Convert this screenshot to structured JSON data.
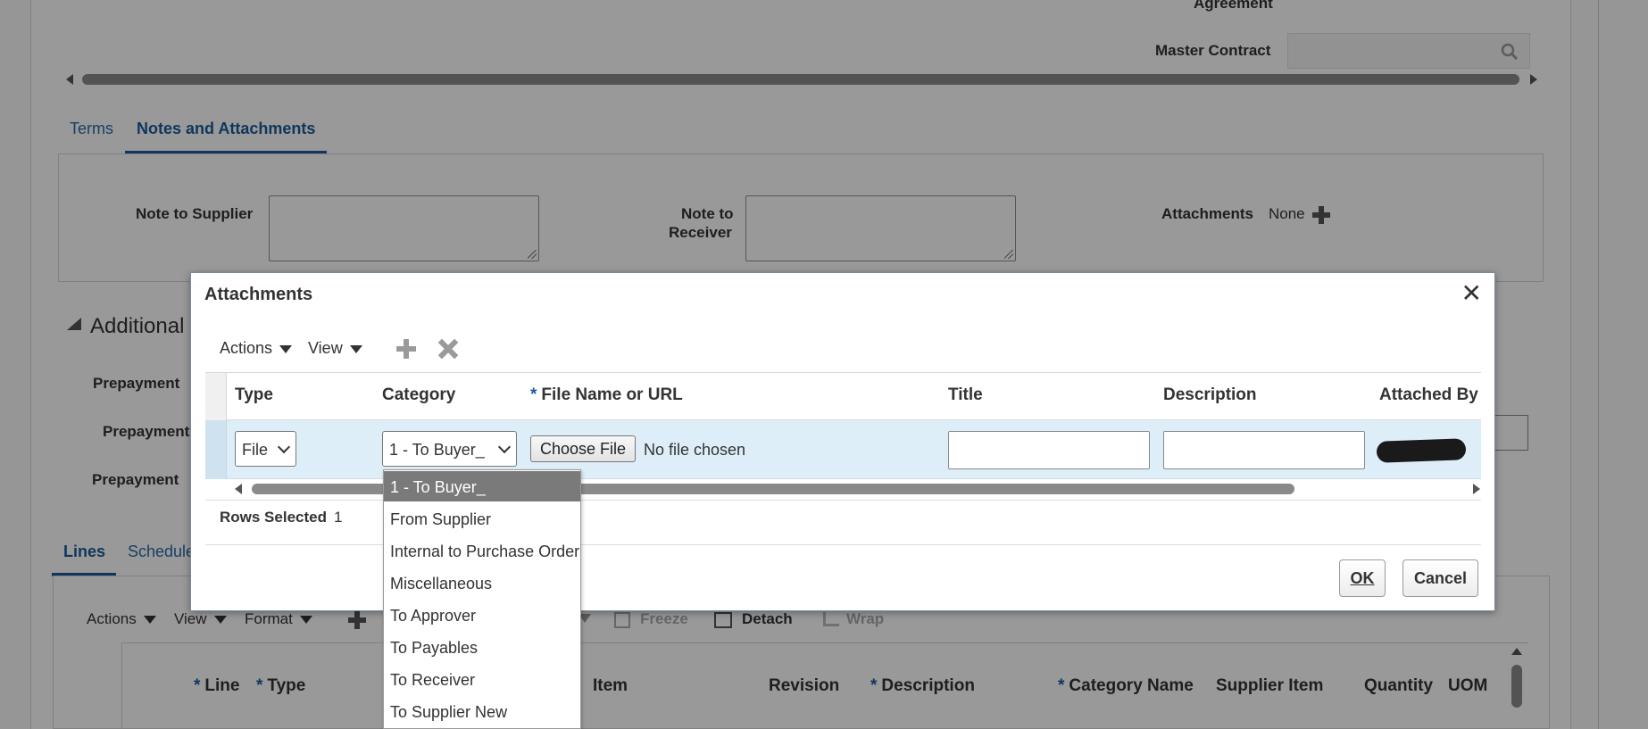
{
  "background": {
    "agreement_label": "Agreement",
    "master_contract_label": "Master Contract",
    "tabs": [
      {
        "label": "Terms",
        "active": false
      },
      {
        "label": "Notes and Attachments",
        "active": true
      }
    ],
    "note_to_supplier_label": "Note to Supplier",
    "note_to_receiver_label_line1": "Note to",
    "note_to_receiver_label_line2": "Receiver",
    "attachments_label": "Attachments",
    "attachments_value": "None",
    "additional_section_title": "Additional",
    "prepayment_labels": [
      "Prepayment",
      "Prepayment",
      "Prepayment"
    ],
    "lower_tabs": [
      {
        "label": "Lines",
        "active": true
      },
      {
        "label": "Schedule",
        "active": false
      }
    ],
    "lines_toolbar": {
      "actions": "Actions",
      "view": "View",
      "format": "Format",
      "freeze": "Freeze",
      "detach": "Detach",
      "wrap": "Wrap"
    },
    "lines_columns": {
      "line": "Line",
      "type": "Type",
      "item": "Item",
      "revision": "Revision",
      "description": "Description",
      "category_name": "Category Name",
      "supplier_item": "Supplier Item",
      "quantity": "Quantity",
      "uom": "UOM"
    }
  },
  "dialog": {
    "title": "Attachments",
    "toolbar": {
      "actions": "Actions",
      "view": "View"
    },
    "columns": {
      "type": "Type",
      "category": "Category",
      "file_name": "File Name or URL",
      "title": "Title",
      "description": "Description",
      "attached_by": "Attached By"
    },
    "required_mark": "*",
    "row": {
      "type_value": "File",
      "category_value": "1 - To Buyer_",
      "choose_file_label": "Choose File",
      "no_file_text": "No file chosen"
    },
    "rows_selected_label": "Rows Selected",
    "rows_selected_value": "1",
    "ok_label": "OK",
    "cancel_label": "Cancel"
  },
  "category_options": [
    "1 - To Buyer_",
    "From Supplier",
    "Internal to Purchase Order",
    "Miscellaneous",
    "To Approver",
    "To Payables",
    "To Receiver",
    "To Supplier New"
  ],
  "colors": {
    "link_blue": "#1c5b99",
    "selected_row": "#deeef9",
    "dropdown_selected": "#7a7a7a"
  }
}
